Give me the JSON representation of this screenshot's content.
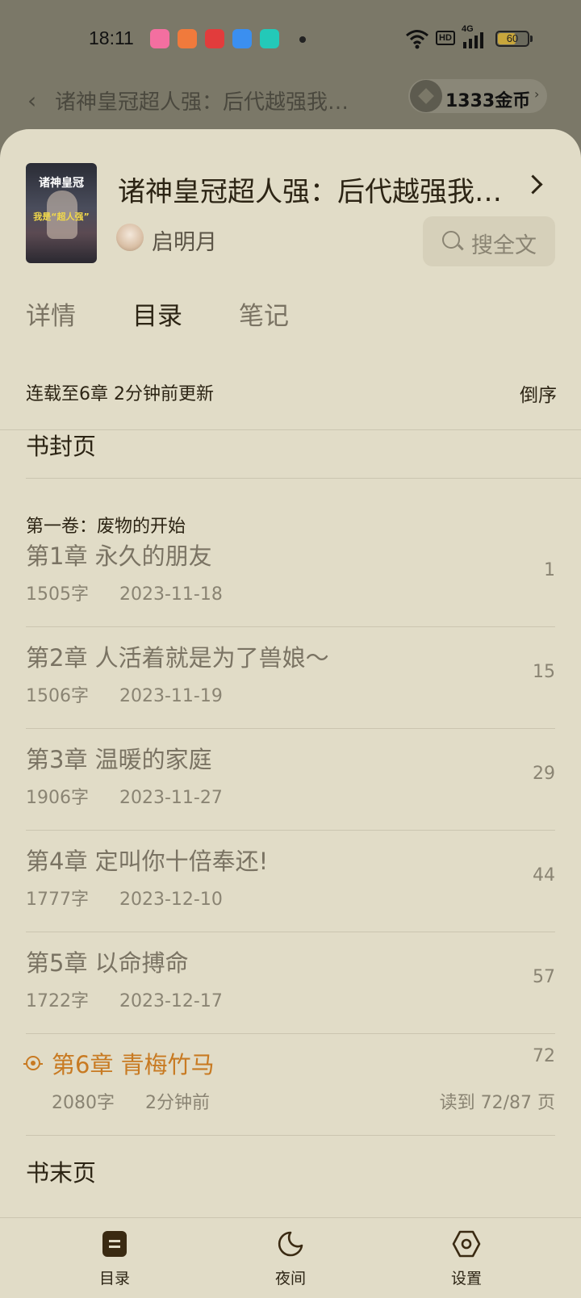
{
  "status_bar": {
    "time": "18:11",
    "network": "4G",
    "hd_badge": "HD",
    "battery_level": "60",
    "battery_fraction": 0.6,
    "app_icons": [
      {
        "name": "bilibili-comics-icon",
        "color": "#f36fa0"
      },
      {
        "name": "reader-icon",
        "color": "#f07a3c"
      },
      {
        "name": "heart-app-icon",
        "color": "#e23c3c"
      },
      {
        "name": "blue-app-icon",
        "color": "#3b8ff0"
      },
      {
        "name": "b-app-icon",
        "color": "#23c9b8"
      }
    ]
  },
  "reader_header": {
    "title": "诸神皇冠超人强：后代越强我…",
    "coins": "1333金币"
  },
  "book": {
    "title": "诸神皇冠超人强：后代越强我…",
    "author": "启明月",
    "search_label": "搜全文",
    "cover_title": "诸神皇冠",
    "cover_subtitle": "我是“超人强”"
  },
  "tabs": [
    {
      "label": "详情",
      "active": false
    },
    {
      "label": "目录",
      "active": true
    },
    {
      "label": "笔记",
      "active": false
    }
  ],
  "catalog": {
    "status": "连载至6章 2分钟前更新",
    "sort_label": "倒序",
    "cover_page": "书封页",
    "volume": "第一卷：废物的开始",
    "end_page": "书末页",
    "chapters": [
      {
        "title": "第1章 永久的朋友",
        "words": "1505字",
        "date": "2023-11-18",
        "page": "1"
      },
      {
        "title": "第2章 人活着就是为了兽娘～",
        "words": "1506字",
        "date": "2023-11-19",
        "page": "15"
      },
      {
        "title": "第3章 温暖的家庭",
        "words": "1906字",
        "date": "2023-11-27",
        "page": "29"
      },
      {
        "title": "第4章 定叫你十倍奉还!",
        "words": "1777字",
        "date": "2023-12-10",
        "page": "44"
      },
      {
        "title": "第5章 以命搏命",
        "words": "1722字",
        "date": "2023-12-17",
        "page": "57"
      },
      {
        "title": "第6章 青梅竹马",
        "words": "2080字",
        "date": "2分钟前",
        "page": "72",
        "progress": "读到 72/87 页",
        "current": true
      }
    ]
  },
  "bottom_nav": [
    {
      "label": "目录",
      "icon": "catalog-icon"
    },
    {
      "label": "夜间",
      "icon": "moon-icon"
    },
    {
      "label": "设置",
      "icon": "settings-hexagon-icon"
    }
  ],
  "colors": {
    "sheet_bg": "#e1dcc7",
    "accent": "#c87a22",
    "text_dark": "#2c2414",
    "text_muted": "#7a7363"
  }
}
